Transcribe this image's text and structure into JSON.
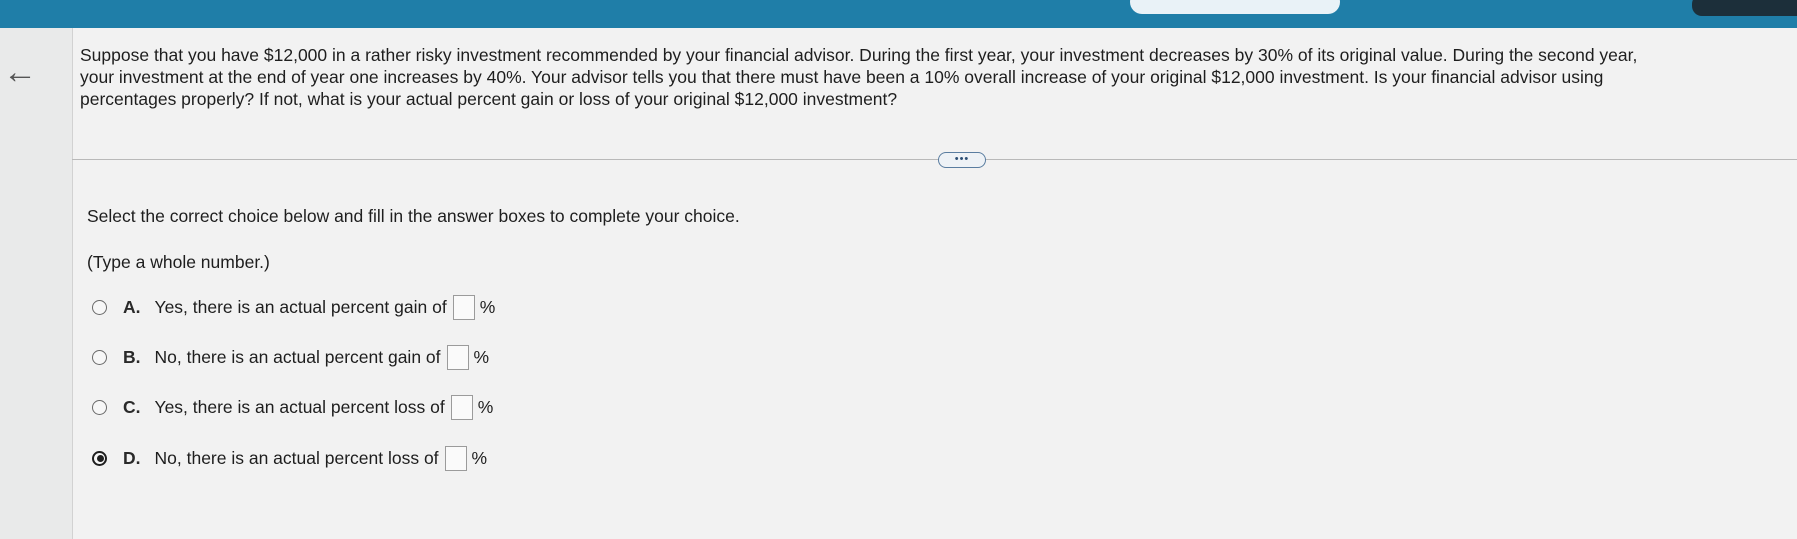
{
  "nav": {
    "back_icon": "←"
  },
  "question": {
    "line1": "Suppose that you have $12,000 in a rather risky investment recommended by your financial advisor. During the first year, your investment decreases by 30% of its original value. During the second year,",
    "line2": "your investment at the end of year one increases by 40%. Your advisor tells you that there must have been a 10% overall increase of your original $12,000 investment. Is your financial advisor using",
    "line3": "percentages properly? If not, what is your actual percent gain or loss of your original $12,000 investment?"
  },
  "more_button": {
    "label": "•••"
  },
  "instructions": "Select the correct choice below and fill in the answer boxes to complete your choice.",
  "hint": "(Type a whole number.)",
  "choices": [
    {
      "letter": "A.",
      "text": "Yes, there is an actual percent gain of",
      "value": "",
      "unit": "%",
      "selected": false
    },
    {
      "letter": "B.",
      "text": "No, there is an actual percent gain of",
      "value": "",
      "unit": "%",
      "selected": false
    },
    {
      "letter": "C.",
      "text": "Yes, there is an actual percent loss of",
      "value": "",
      "unit": "%",
      "selected": false
    },
    {
      "letter": "D.",
      "text": "No, there is an actual percent loss of",
      "value": "",
      "unit": "%",
      "selected": true
    }
  ]
}
